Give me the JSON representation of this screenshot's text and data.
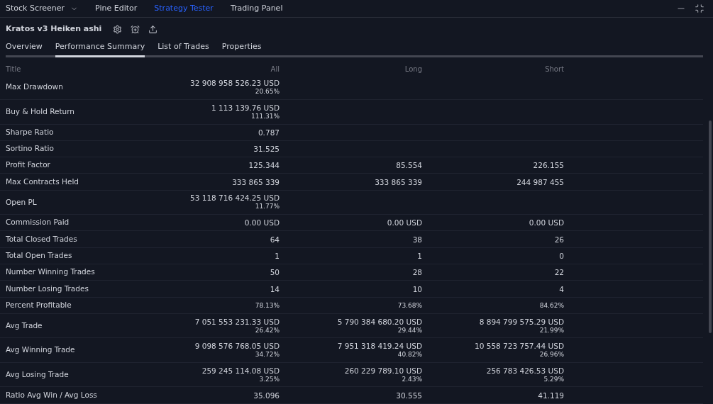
{
  "top_tabs": [
    {
      "label": "Stock Screener",
      "has_menu": true,
      "selected": false
    },
    {
      "label": "Pine Editor",
      "has_menu": false,
      "selected": false
    },
    {
      "label": "Strategy Tester",
      "has_menu": false,
      "selected": true
    },
    {
      "label": "Trading Panel",
      "has_menu": false,
      "selected": false
    }
  ],
  "strategy": {
    "title": "Kratos v3 Heiken ashi"
  },
  "tabs": [
    {
      "label": "Overview",
      "selected": false
    },
    {
      "label": "Performance Summary",
      "selected": true
    },
    {
      "label": "List of Trades",
      "selected": false
    },
    {
      "label": "Properties",
      "selected": false
    }
  ],
  "table": {
    "columns": [
      "Title",
      "All",
      "Long",
      "Short"
    ],
    "rows": [
      {
        "cells": [
          {
            "value": "Max Drawdown"
          },
          {
            "value": "32 908 958 526.23 USD",
            "percent": "20.65%"
          },
          {},
          {}
        ]
      },
      {
        "cells": [
          {
            "value": "Buy & Hold Return"
          },
          {
            "value": "1 113 139.76 USD",
            "percent": "111.31%"
          },
          {},
          {}
        ]
      },
      {
        "cells": [
          {
            "value": "Sharpe Ratio"
          },
          {
            "value": "0.787"
          },
          {},
          {}
        ]
      },
      {
        "cells": [
          {
            "value": "Sortino Ratio"
          },
          {
            "value": "31.525"
          },
          {},
          {}
        ]
      },
      {
        "cells": [
          {
            "value": "Profit Factor"
          },
          {
            "value": "125.344"
          },
          {
            "value": "85.554"
          },
          {
            "value": "226.155"
          }
        ]
      },
      {
        "cells": [
          {
            "value": "Max Contracts Held"
          },
          {
            "value": "333 865 339"
          },
          {
            "value": "333 865 339"
          },
          {
            "value": "244 987 455"
          }
        ]
      },
      {
        "cells": [
          {
            "value": "Open PL"
          },
          {
            "value": "53 118 716 424.25 USD",
            "percent": "11.77%"
          },
          {},
          {}
        ]
      },
      {
        "cells": [
          {
            "value": "Commission Paid"
          },
          {
            "value": "0.00 USD"
          },
          {
            "value": "0.00 USD"
          },
          {
            "value": "0.00 USD"
          }
        ]
      },
      {
        "cells": [
          {
            "value": "Total Closed Trades"
          },
          {
            "value": "64"
          },
          {
            "value": "38"
          },
          {
            "value": "26"
          }
        ]
      },
      {
        "cells": [
          {
            "value": "Total Open Trades"
          },
          {
            "value": "1"
          },
          {
            "value": "1"
          },
          {
            "value": "0"
          }
        ]
      },
      {
        "cells": [
          {
            "value": "Number Winning Trades"
          },
          {
            "value": "50"
          },
          {
            "value": "28"
          },
          {
            "value": "22"
          }
        ]
      },
      {
        "cells": [
          {
            "value": "Number Losing Trades"
          },
          {
            "value": "14"
          },
          {
            "value": "10"
          },
          {
            "value": "4"
          }
        ]
      },
      {
        "cells": [
          {
            "value": "Percent Profitable"
          },
          {
            "percent": "78.13%"
          },
          {
            "percent": "73.68%"
          },
          {
            "percent": "84.62%"
          }
        ]
      },
      {
        "cells": [
          {
            "value": "Avg Trade"
          },
          {
            "value": "7 051 553 231.33 USD",
            "percent": "26.42%"
          },
          {
            "value": "5 790 384 680.20 USD",
            "percent": "29.44%"
          },
          {
            "value": "8 894 799 575.29 USD",
            "percent": "21.99%"
          }
        ]
      },
      {
        "cells": [
          {
            "value": "Avg Winning Trade"
          },
          {
            "value": "9 098 576 768.05 USD",
            "percent": "34.72%"
          },
          {
            "value": "7 951 318 419.24 USD",
            "percent": "40.82%"
          },
          {
            "value": "10 558 723 757.44 USD",
            "percent": "26.96%"
          }
        ]
      },
      {
        "cells": [
          {
            "value": "Avg Losing Trade"
          },
          {
            "value": "259 245 114.08 USD",
            "percent": "3.25%"
          },
          {
            "value": "260 229 789.10 USD",
            "percent": "2.43%"
          },
          {
            "value": "256 783 426.53 USD",
            "percent": "5.29%"
          }
        ]
      },
      {
        "cells": [
          {
            "value": "Ratio Avg Win / Avg Loss"
          },
          {
            "value": "35.096"
          },
          {
            "value": "30.555"
          },
          {
            "value": "41.119"
          }
        ]
      }
    ]
  }
}
